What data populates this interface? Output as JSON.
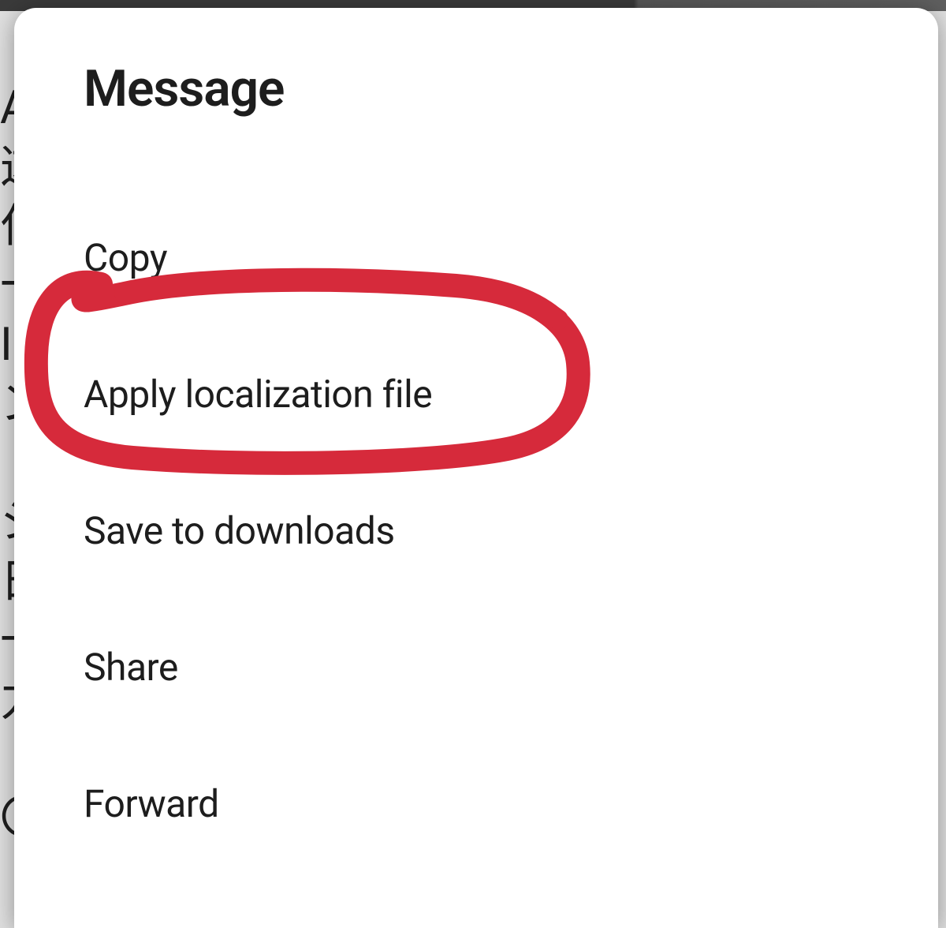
{
  "dialog": {
    "title": "Message",
    "items": [
      {
        "label": "Copy"
      },
      {
        "label": "Apply localization file"
      },
      {
        "label": "Save to downloads"
      },
      {
        "label": "Share"
      },
      {
        "label": "Forward"
      }
    ]
  },
  "annotation": {
    "color": "#d62a3b",
    "target_index": 1
  },
  "background_hint_chars": "A这仁I シ日力〇"
}
